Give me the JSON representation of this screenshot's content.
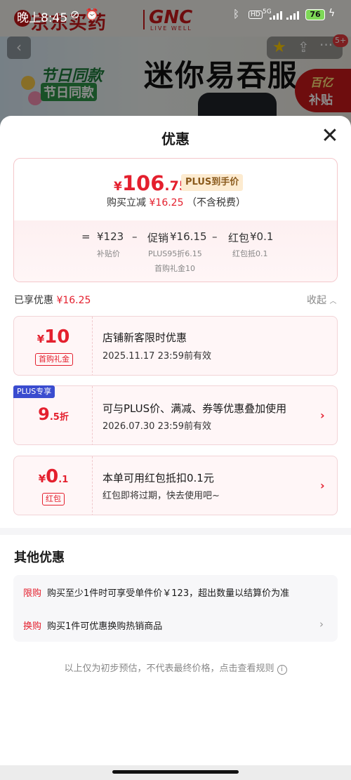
{
  "status": {
    "time": "晚上8:45",
    "network": "5G",
    "battery": "76"
  },
  "background": {
    "store_logo": "京东买药",
    "brand_logo": "GNC",
    "brand_sub": "LIVE WELL",
    "headline": "迷你易吞服",
    "festival_line1": "节日同款",
    "festival_script": "节日同款",
    "subsidy_top": "百亿",
    "subsidy_bottom": "补贴",
    "cart_badge": "5+"
  },
  "sheet": {
    "title": "优惠",
    "price_card": {
      "currency": "¥",
      "price_int": "106",
      "price_dec": ".75",
      "plus_tag": "PLUS到手价",
      "reduce_prefix": "购买立减",
      "reduce_amount": "¥16.25",
      "reduce_suffix": "（不含税费）",
      "eq_sign": "=",
      "base_price": "¥123",
      "base_label": "补贴价",
      "minus1": "–",
      "promo_label": "促销",
      "promo_amount": "¥16.15",
      "promo_sub1": "PLUS95折6.15",
      "promo_sub2": "首购礼金10",
      "minus2": "–",
      "redpack_label": "红包",
      "redpack_amount": "¥0.1",
      "redpack_sub": "红包抵0.1"
    },
    "enjoyed_label": "已享优惠",
    "enjoyed_amount": "¥16.25",
    "collapse_label": "收起",
    "coupons": [
      {
        "currency": "¥",
        "amount": "10",
        "tag": "首购礼金",
        "title": "店铺新客限时优惠",
        "desc": "2025.11.17 23:59前有效"
      },
      {
        "badge": "PLUS专享",
        "amount": "9",
        "amount_dec": ".5折",
        "title": "可与PLUS价、满减、券等优惠叠加使用",
        "desc": "2026.07.30 23:59前有效"
      },
      {
        "currency": "¥",
        "amount": "0",
        "amount_dec": ".1",
        "tag": "红包",
        "title": "本单可用红包抵扣0.1元",
        "desc": "红包即将过期，快去使用吧~"
      }
    ],
    "other_title": "其他优惠",
    "other_rows": [
      {
        "key": "限购",
        "text": "购买至少1件时可享受单件价￥123，超出数量以结算价为准"
      },
      {
        "key": "换购",
        "text": "购买1件可优惠换购热销商品"
      }
    ],
    "footnote": "以上仅为初步预估，不代表最终价格，点击查看规则",
    "info_glyph": "i"
  },
  "colors": {
    "accent_red": "#e4202e",
    "plus_blue": "#3a4ccf",
    "card_pink": "#fff6f7"
  }
}
